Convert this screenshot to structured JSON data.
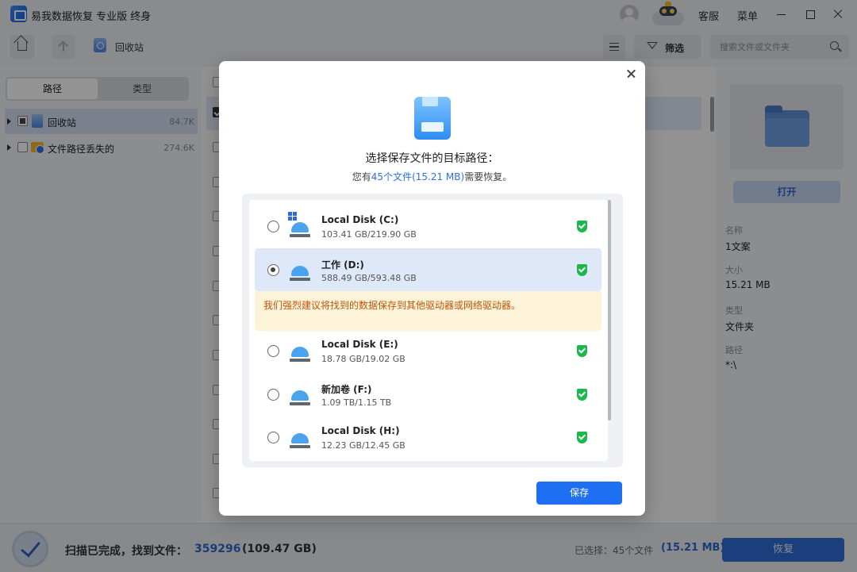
{
  "app": {
    "title": "易我数据恢复 专业版 终身"
  },
  "titlebar": {
    "service": "客服",
    "menu": "菜单"
  },
  "toolbar": {
    "breadcrumb": "回收站",
    "filter_label": "筛选",
    "search_placeholder": "搜索文件或文件夹"
  },
  "left_panel": {
    "tabs": [
      {
        "label": "路径",
        "active": true
      },
      {
        "label": "类型",
        "active": false
      }
    ],
    "tree": [
      {
        "label": "回收站",
        "size": "84.7K",
        "icon": "recycle-bin-icon",
        "check": "partial",
        "selected": true
      },
      {
        "label": "文件路径丢失的",
        "size": "274.6K",
        "icon": "lost-path-icon",
        "check": "none",
        "selected": false
      }
    ]
  },
  "right_panel": {
    "open_label": "打开",
    "props": [
      {
        "label": "名称",
        "value": "1文案"
      },
      {
        "label": "大小",
        "value": "15.21 MB"
      },
      {
        "label": "类型",
        "value": "文件夹"
      },
      {
        "label": "路径",
        "value": "*:\\"
      }
    ]
  },
  "status": {
    "scan_message": "扫描已完成，找到文件：",
    "found_count": "359296",
    "found_size": "(109.47 GB)",
    "selected_label": "已选择：45个文件",
    "selected_size": "(15.21 MB)",
    "recover_label": "恢复"
  },
  "dialog": {
    "title": "选择保存文件的目标路径：",
    "sub_prefix": "您有",
    "sub_highlight": "45个文件(15.21 MB)",
    "sub_suffix": "需要恢复。",
    "warning": "我们强烈建议将找到的数据保存到其他驱动器或网络驱动器。",
    "save_label": "保存",
    "drives": [
      {
        "name": "Local Disk (C:)",
        "usage": "103.41 GB/219.90 GB",
        "selected": false,
        "system": true
      },
      {
        "name": "工作 (D:)",
        "usage": "588.49 GB/593.48 GB",
        "selected": true,
        "system": false
      },
      {
        "name": "Local Disk (E:)",
        "usage": "18.78 GB/19.02 GB",
        "selected": false,
        "system": false
      },
      {
        "name": "新加卷 (F:)",
        "usage": "1.09 TB/1.15 TB",
        "selected": false,
        "system": false
      },
      {
        "name": "Local Disk (H:)",
        "usage": "12.23 GB/12.45 GB",
        "selected": false,
        "system": false
      }
    ]
  },
  "colors": {
    "accent": "#1e6ff1",
    "warning_bg": "#fdf3d8",
    "warning_text": "#c0540a",
    "safe": "#1cb84c"
  }
}
